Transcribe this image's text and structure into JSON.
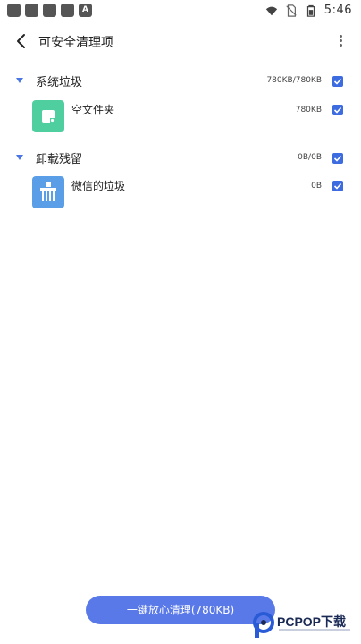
{
  "status_bar": {
    "notification_icons": [
      "app-icon",
      "app-icon",
      "app-icon",
      "app-icon",
      "A"
    ],
    "time": "5:46"
  },
  "header": {
    "back_icon": "back-arrow-icon",
    "title": "可安全清理项",
    "more_icon": "more-vertical-icon"
  },
  "groups": [
    {
      "title": "系统垃圾",
      "size": "780KB/780KB",
      "checked": true,
      "items": [
        {
          "name": "空文件夹",
          "size": "780KB",
          "icon": "folder-icon",
          "icon_color": "#4fcf9f",
          "checked": true
        }
      ]
    },
    {
      "title": "卸载残留",
      "size": "0B/0B",
      "checked": true,
      "items": [
        {
          "name": "微信的垃圾",
          "size": "0B",
          "icon": "trash-shredder-icon",
          "icon_color": "#5a9ee8",
          "checked": true
        }
      ]
    }
  ],
  "footer": {
    "clean_button": "一键放心清理(780KB)"
  },
  "watermark": {
    "text": "PCPOP下载"
  },
  "colors": {
    "accent": "#3d6be0",
    "button": "#5a79e8"
  }
}
